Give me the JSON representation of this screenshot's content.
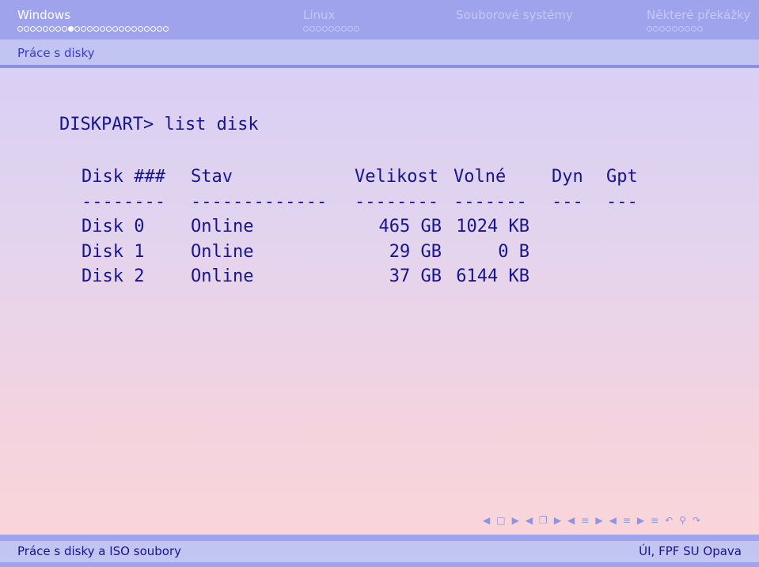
{
  "header": {
    "sections": [
      {
        "title": "Windows",
        "active": true,
        "dots_total": 24,
        "dot_filled": 8
      },
      {
        "title": "Linux",
        "active": false,
        "dots_total": 9,
        "dot_filled": -1
      },
      {
        "title": "Souborové systémy",
        "active": false,
        "dots_total": 0,
        "dot_filled": -1
      },
      {
        "title": "Některé překážky",
        "active": false,
        "dots_total": 9,
        "dot_filled": -1
      }
    ],
    "subsection": "Práce s disky"
  },
  "content": {
    "prompt": "DISKPART> list disk",
    "columns": [
      "Disk ###",
      "Stav",
      "Velikost",
      "Volné",
      "Dyn",
      "Gpt"
    ],
    "separators": [
      "--------",
      "-------------",
      "--------",
      "-------",
      "---",
      "---"
    ],
    "rows": [
      [
        "Disk 0",
        "Online",
        "465 GB",
        "1024 KB",
        "",
        ""
      ],
      [
        "Disk 1",
        "Online",
        "29 GB",
        "0 B",
        "",
        ""
      ],
      [
        "Disk 2",
        "Online",
        "37 GB",
        "6144 KB",
        "",
        ""
      ]
    ]
  },
  "footer": {
    "left": "Práce s disky a ISO soubory",
    "right": "ÚI, FPF SU Opava"
  },
  "colors": {
    "header_bg": "#9fa3eb",
    "subheader_bg": "#c2c4f1",
    "text": "#17148f"
  }
}
